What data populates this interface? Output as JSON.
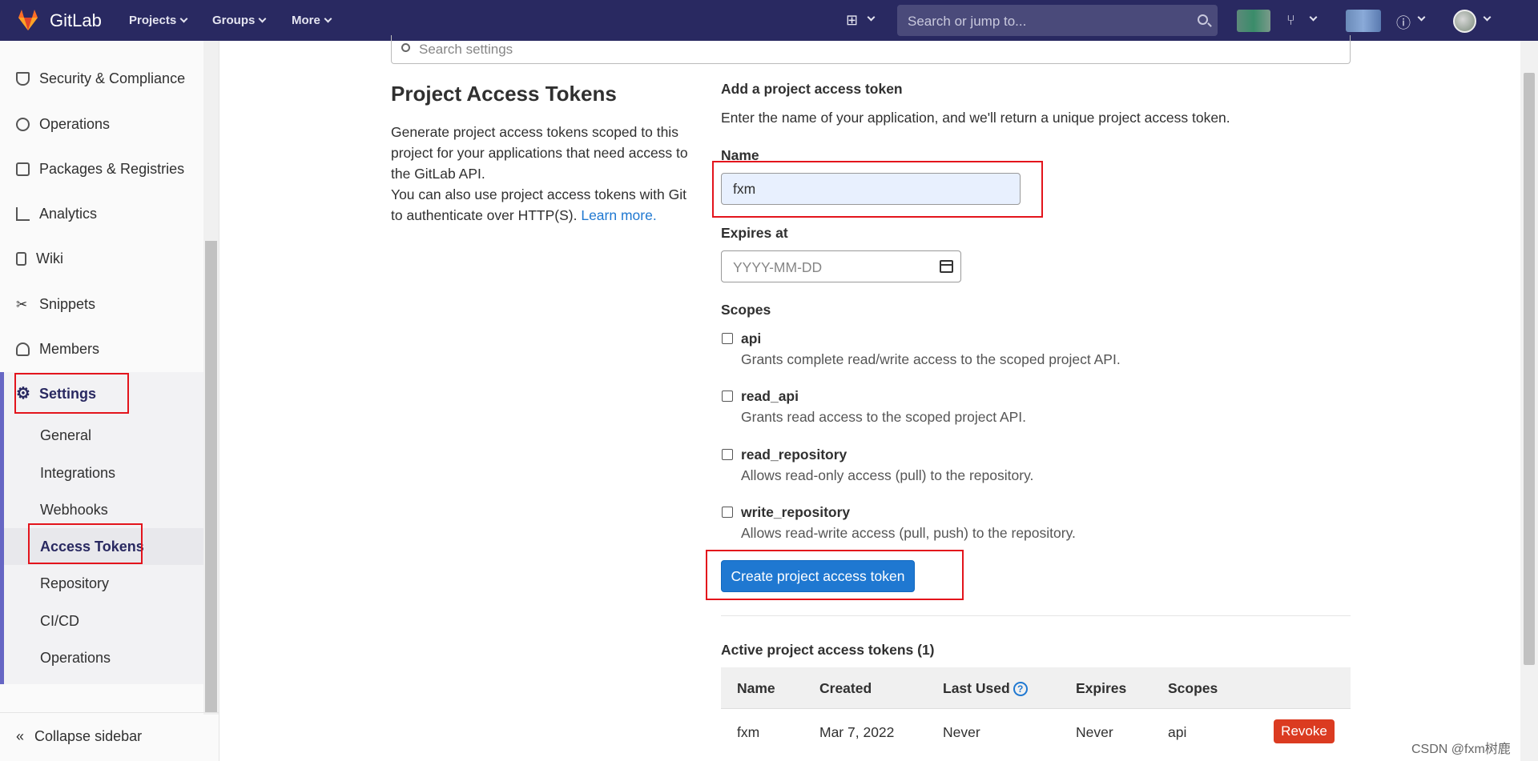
{
  "topbar": {
    "brand": "GitLab",
    "nav": [
      "Projects",
      "Groups",
      "More"
    ],
    "search_placeholder": "Search or jump to...",
    "accent": "#292961"
  },
  "sidebar": {
    "items": [
      {
        "label": "Security & Compliance",
        "icon": "shield-icon"
      },
      {
        "label": "Operations",
        "icon": "cloud-gear-icon"
      },
      {
        "label": "Packages & Registries",
        "icon": "package-icon"
      },
      {
        "label": "Analytics",
        "icon": "chart-icon"
      },
      {
        "label": "Wiki",
        "icon": "book-icon"
      },
      {
        "label": "Snippets",
        "icon": "scissors-icon"
      },
      {
        "label": "Members",
        "icon": "users-icon"
      },
      {
        "label": "Settings",
        "icon": "gear-icon"
      }
    ],
    "settings_sub": [
      "General",
      "Integrations",
      "Webhooks",
      "Access Tokens",
      "Repository",
      "CI/CD",
      "Operations"
    ],
    "collapse": "Collapse sidebar"
  },
  "main": {
    "settings_search_placeholder": "Search settings",
    "title": "Project Access Tokens",
    "desc_1": "Generate project access tokens scoped to this project for your applications that need access to the GitLab API.",
    "desc_2": "You can also use project access tokens with Git to authenticate over HTTP(S).",
    "learn_more": "Learn more.",
    "form": {
      "title": "Add a project access token",
      "desc": "Enter the name of your application, and we'll return a unique project access token.",
      "name_label": "Name",
      "name_value": "fxm",
      "expires_label": "Expires at",
      "expires_placeholder": "YYYY-MM-DD",
      "scopes_label": "Scopes",
      "scopes": [
        {
          "name": "api",
          "desc": "Grants complete read/write access to the scoped project API."
        },
        {
          "name": "read_api",
          "desc": "Grants read access to the scoped project API."
        },
        {
          "name": "read_repository",
          "desc": "Allows read-only access (pull) to the repository."
        },
        {
          "name": "write_repository",
          "desc": "Allows read-write access (pull, push) to the repository."
        }
      ],
      "create_button": "Create project access token"
    },
    "active": {
      "title": "Active project access tokens (1)",
      "headers": [
        "Name",
        "Created",
        "Last Used",
        "Expires",
        "Scopes"
      ],
      "rows": [
        {
          "name": "fxm",
          "created": "Mar 7, 2022",
          "last_used": "Never",
          "expires": "Never",
          "scopes": "api",
          "action": "Revoke"
        }
      ]
    }
  },
  "watermark": "CSDN @fxm树鹿"
}
